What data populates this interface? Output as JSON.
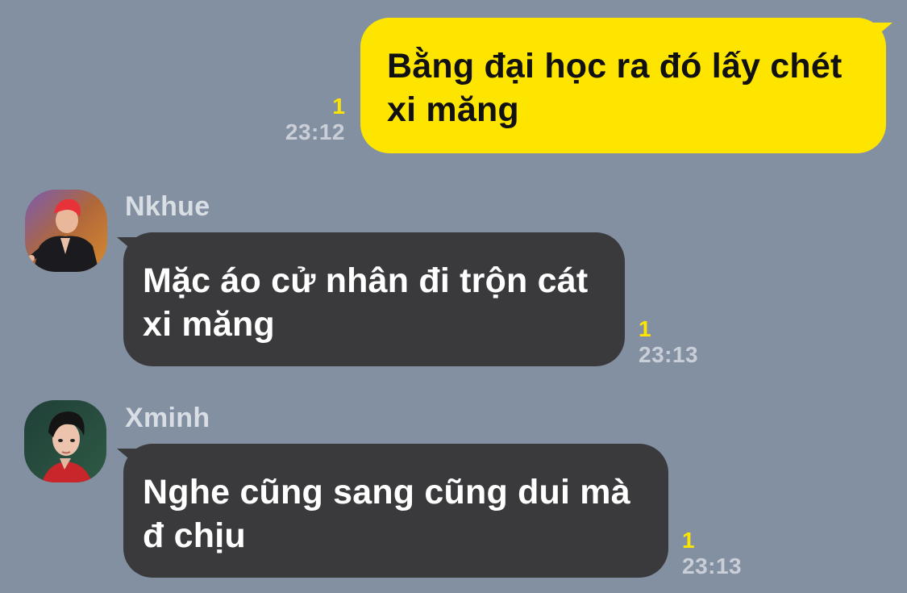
{
  "messages": [
    {
      "sender": "me",
      "text": "Bằng đại học ra đó lấy chét xi măng",
      "unread": "1",
      "time": "23:12"
    },
    {
      "sender": "Nkhue",
      "text": "Mặc áo cử nhân đi trộn cát xi măng",
      "unread": "1",
      "time": "23:13"
    },
    {
      "sender": "Xminh",
      "text": "Nghe cũng sang cũng dui mà đ chịu",
      "unread": "1",
      "time": "23:13"
    }
  ],
  "colors": {
    "background": "#8390a2",
    "my_bubble": "#fee500",
    "their_bubble": "#3a3a3d",
    "unread_count": "#fee500",
    "timestamp": "#c9ced7"
  },
  "icons": {
    "nkhue_avatar": "avatar-nkhue",
    "xminh_avatar": "avatar-xminh"
  }
}
